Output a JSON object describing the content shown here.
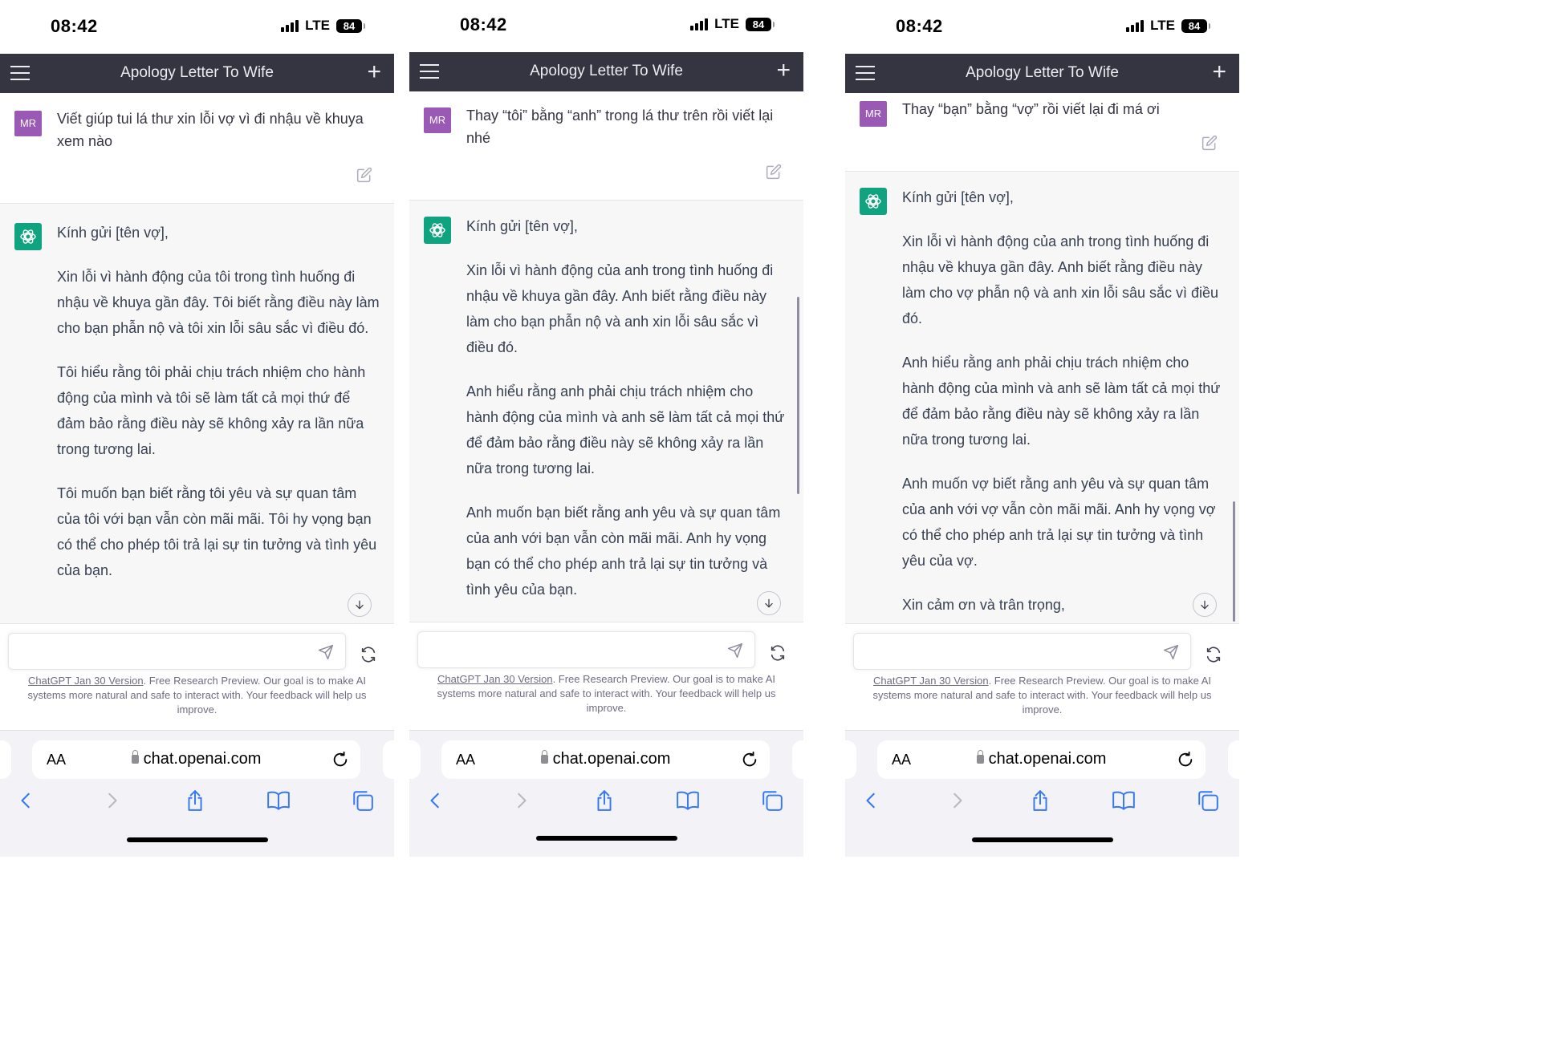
{
  "colors": {
    "nav_bg": "#343541",
    "ai_bg": "#f7f7f8",
    "gpt_green": "#10a37f",
    "user_avatar": "#9b59b6",
    "ios_blue": "#3478f6"
  },
  "phones": [
    {
      "status": {
        "time": "08:42",
        "network": "LTE",
        "battery": "84"
      },
      "header": {
        "title": "Apology Letter To Wife",
        "menu_icon": "hamburger-icon",
        "new_chat_icon": "plus-icon"
      },
      "user": {
        "avatar": "MR",
        "text": "Viết giúp tui lá thư xin lỗi vợ vì đi nhậu về khuya xem nào"
      },
      "ai": {
        "greeting": "Kính gửi [tên vợ],",
        "p1": "Xin lỗi vì hành động của tôi trong tình huống đi nhậu về khuya gần đây. Tôi biết rằng điều này làm cho bạn phẫn nộ và tôi xin lỗi sâu sắc vì điều đó.",
        "p2": "Tôi hiểu rằng tôi phải chịu trách nhiệm cho hành động của mình và tôi sẽ làm tất cả mọi thứ để đảm bảo rằng điều này sẽ không xảy ra lần nữa trong tương lai.",
        "p3": "Tôi muốn bạn biết rằng tôi yêu và sự quan tâm của tôi với bạn vẫn còn mãi mãi. Tôi hy vọng bạn có thể cho phép tôi trả lại sự tin tưởng và tình yêu của bạn.",
        "p4": ""
      },
      "footer": {
        "link": "ChatGPT Jan 30 Version",
        "note": ". Free Research Preview. Our goal is to make AI systems more natural and safe to interact with. Your feedback will help us improve."
      },
      "safari": {
        "aa": "AA",
        "url": "chat.openai.com"
      }
    },
    {
      "status": {
        "time": "08:42",
        "network": "LTE",
        "battery": "84"
      },
      "header": {
        "title": "Apology Letter To Wife",
        "menu_icon": "hamburger-icon",
        "new_chat_icon": "plus-icon"
      },
      "user": {
        "avatar": "MR",
        "text": "Thay “tôi” bằng “anh” trong lá thư trên rồi viết lại nhé"
      },
      "ai": {
        "greeting": "Kính gửi [tên vợ],",
        "p1": "Xin lỗi vì hành động của anh trong tình huống đi nhậu về khuya gần đây. Anh biết rằng điều này làm cho bạn phẫn nộ và anh xin lỗi sâu sắc vì điều đó.",
        "p2": "Anh hiểu rằng anh phải chịu trách nhiệm cho hành động của mình và anh sẽ làm tất cả mọi thứ để đảm bảo rằng điều này sẽ không xảy ra lần nữa trong tương lai.",
        "p3": "Anh muốn bạn biết rằng anh yêu và sự quan tâm của anh với bạn vẫn còn mãi mãi. Anh hy vọng bạn có thể cho phép anh trả lại sự tin tưởng và tình yêu của bạn.",
        "p4": ""
      },
      "footer": {
        "link": "ChatGPT Jan 30 Version",
        "note": ". Free Research Preview. Our goal is to make AI systems more natural and safe to interact with. Your feedback will help us improve."
      },
      "safari": {
        "aa": "AA",
        "url": "chat.openai.com"
      }
    },
    {
      "status": {
        "time": "08:42",
        "network": "LTE",
        "battery": "84"
      },
      "header": {
        "title": "Apology Letter To Wife",
        "menu_icon": "hamburger-icon",
        "new_chat_icon": "plus-icon"
      },
      "user": {
        "avatar": "MR",
        "text": "Thay “bạn” bằng “vợ” rồi viết lại đi má ơi"
      },
      "ai": {
        "greeting": "Kính gửi [tên vợ],",
        "p1": "Xin lỗi vì hành động của anh trong tình huống đi nhậu về khuya gần đây. Anh biết rằng điều này làm cho vợ phẫn nộ và anh xin lỗi sâu sắc vì điều đó.",
        "p2": "Anh hiểu rằng anh phải chịu trách nhiệm cho hành động của mình và anh sẽ làm tất cả mọi thứ để đảm bảo rằng điều này sẽ không xảy ra lần nữa trong tương lai.",
        "p3": "Anh muốn vợ biết rằng anh yêu và sự quan tâm của anh với vợ vẫn còn mãi mãi. Anh hy vọng vợ có thể cho phép anh trả lại sự tin tưởng và tình yêu của vợ.",
        "p4": "Xin cảm ơn và trân trọng,"
      },
      "footer": {
        "link": "ChatGPT Jan 30 Version",
        "note": ". Free Research Preview. Our goal is to make AI systems more natural and safe to interact with. Your feedback will help us improve."
      },
      "safari": {
        "aa": "AA",
        "url": "chat.openai.com"
      }
    }
  ]
}
